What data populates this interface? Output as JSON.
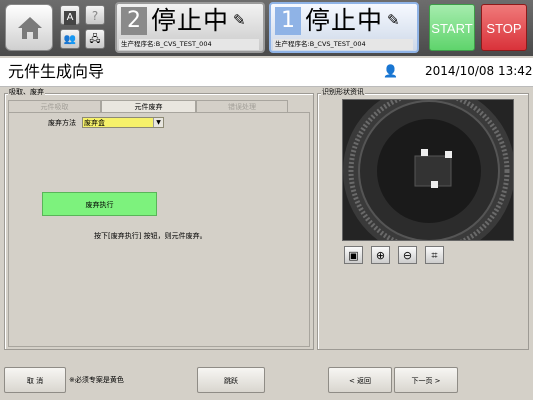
{
  "topbar": {
    "icons": [
      "home-icon",
      "a-icon",
      "help-icon",
      "users-icon",
      "network-icon"
    ],
    "a_label": "A",
    "help_label": "?",
    "panels": [
      {
        "number": "2",
        "status": "停止中",
        "program": "生产程序名:B_CVS_TEST_004",
        "selected": false
      },
      {
        "number": "1",
        "status": "停止中",
        "program": "生产程序名:B_CVS_TEST_004",
        "selected": true
      }
    ],
    "start_label": "START",
    "stop_label": "STOP",
    "start_color": "#5fd46c",
    "stop_color": "#d9323a"
  },
  "header": {
    "title": "元件生成向导",
    "datetime": "2014/10/08 13:42"
  },
  "left": {
    "group_title": "吸取、废弃",
    "tabs": [
      {
        "label": "元件吸取",
        "active": false
      },
      {
        "label": "元件废弃",
        "active": true
      },
      {
        "label": "错误处理",
        "active": false
      }
    ],
    "discard_label": "废弃方法",
    "discard_value": "废弃盒",
    "execute_label": "废弃执行",
    "instruction": "按下[废弃执行] 按钮，则元件废弃。"
  },
  "right": {
    "group_title": "识别形状资讯",
    "tools": [
      "image-icon",
      "zoom-in-icon",
      "zoom-out-icon",
      "fit-icon"
    ]
  },
  "bottom": {
    "cancel_label": "取 消",
    "note": "※必须专案是黄色",
    "skip_label": "跳跃",
    "back_label": "< 返回",
    "next_label": "下一页 >"
  }
}
